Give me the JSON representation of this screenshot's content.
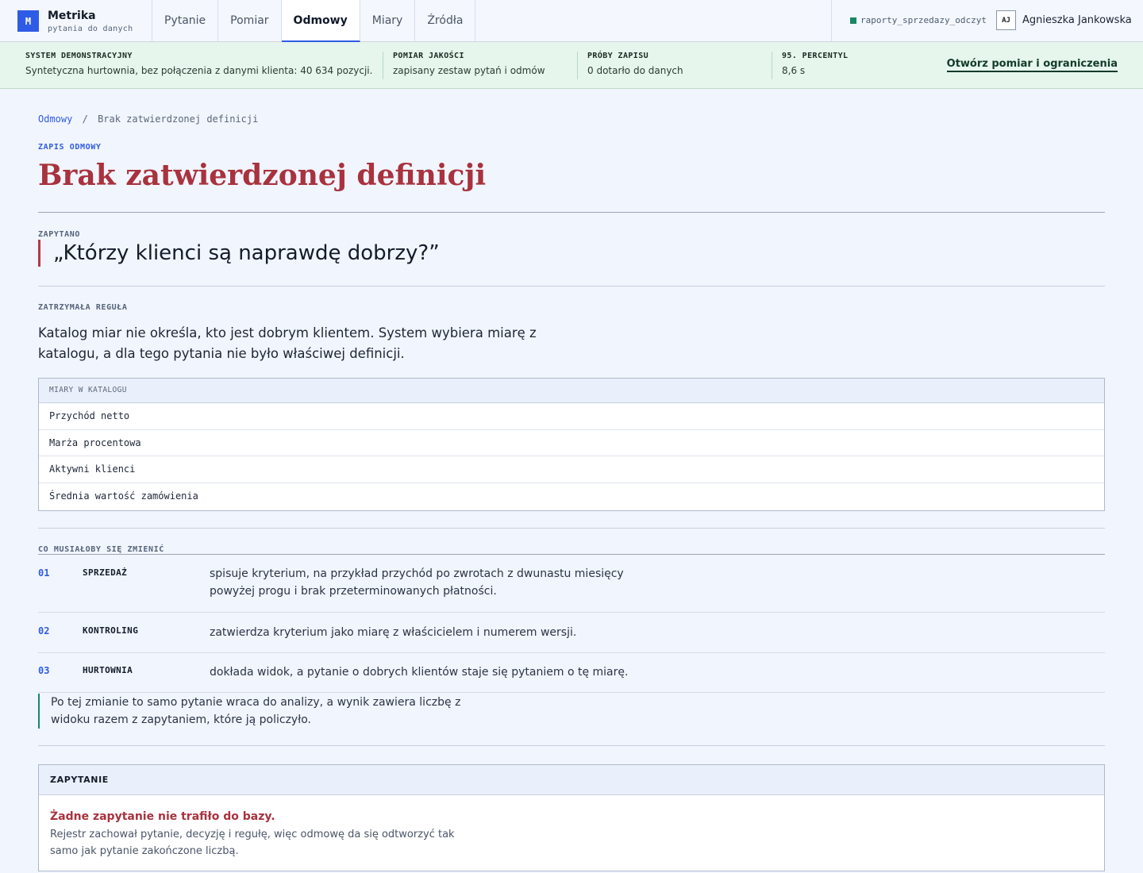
{
  "app": {
    "logo_letter": "M",
    "name": "Metrika",
    "tagline": "pytania do danych"
  },
  "nav": {
    "tabs": [
      {
        "label": "Pytanie",
        "active": false
      },
      {
        "label": "Pomiar",
        "active": false
      },
      {
        "label": "Odmowy",
        "active": true
      },
      {
        "label": "Miary",
        "active": false
      },
      {
        "label": "Źródła",
        "active": false
      }
    ]
  },
  "user": {
    "connection": "raporty_sprzedazy_odczyt",
    "connection_color": "#17866a",
    "initials": "AJ",
    "name": "Agnieszka Jankowska"
  },
  "status": {
    "items": [
      {
        "label": "SYSTEM DEMONSTRACYJNY",
        "value": "Syntetyczna hurtownia, bez połączenia z danymi klienta: 40 634 pozycji."
      },
      {
        "label": "POMIAR JAKOŚCI",
        "value": "zapisany zestaw pytań i odmów"
      },
      {
        "label": "PRÓBY ZAPISU",
        "value": "0 dotarło do danych"
      },
      {
        "label": "95. PERCENTYL",
        "value": "8,6 s"
      }
    ],
    "link": "Otwórz pomiar i ograniczenia"
  },
  "breadcrumb": {
    "parent": "Odmowy",
    "separator": "/",
    "current": "Brak zatwierdzonej definicji"
  },
  "record": {
    "eyebrow": "ZAPIS ODMOWY",
    "title": "Brak zatwierdzonej definicji",
    "title_color": "#a8323e"
  },
  "asked": {
    "label": "ZAPYTANO",
    "question": "„Którzy klienci są naprawdę dobrzy?”"
  },
  "stopping_rule": {
    "label": "ZATRZYMAŁA REGUŁA",
    "text": "Katalog miar nie określa, kto jest dobrym klientem. System wybiera miarę z katalogu, a dla tego pytania nie było właściwej definicji."
  },
  "catalog": {
    "header": "MIARY W KATALOGU",
    "items": [
      "Przychód netto",
      "Marża procentowa",
      "Aktywni klienci",
      "Średnia wartość zamówienia"
    ]
  },
  "changes": {
    "label": "CO MUSIAŁOBY SIĘ ZMIENIĆ",
    "steps": [
      {
        "num": "01",
        "who": "SPRZEDAŻ",
        "text": "spisuje kryterium, na przykład przychód po zwrotach z dwunastu miesięcy powyżej progu i brak przeterminowanych płatności."
      },
      {
        "num": "02",
        "who": "KONTROLING",
        "text": "zatwierdza kryterium jako miarę z właścicielem i numerem wersji."
      },
      {
        "num": "03",
        "who": "HURTOWNIA",
        "text": "dokłada widok, a pytanie o dobrych klientów staje się pytaniem o tę miarę."
      }
    ],
    "outcome": "Po tej zmianie to samo pytanie wraca do analizy, a wynik zawiera liczbę z widoku razem z zapytaniem, które ją policzyło."
  },
  "query": {
    "header": "ZAPYTANIE",
    "title": "Żadne zapytanie nie trafiło do bazy.",
    "description": "Rejestr zachował pytanie, decyzję i regułę, więc odmowę da się odtworzyć tak samo jak pytanie zakończone liczbą."
  }
}
